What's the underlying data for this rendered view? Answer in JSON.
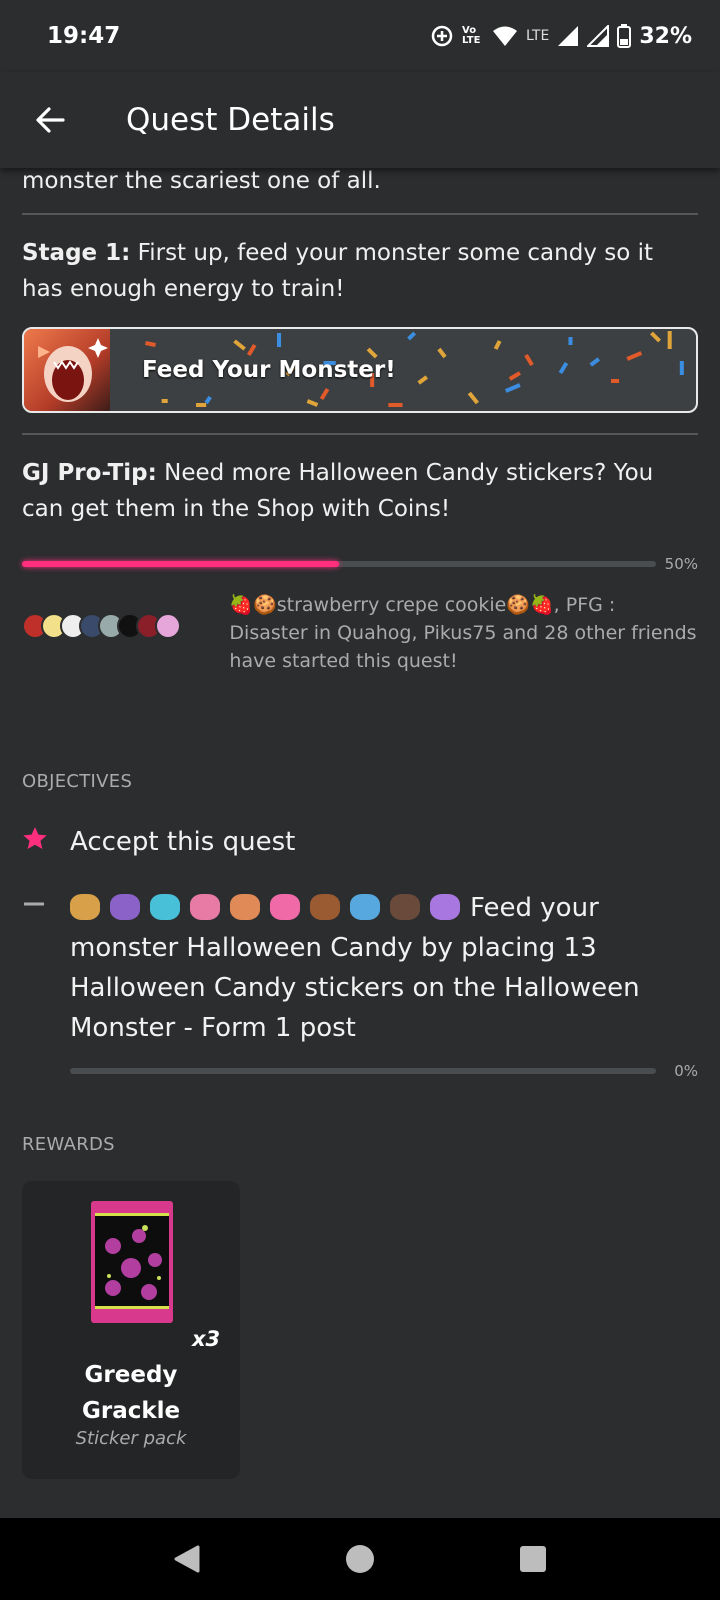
{
  "status_bar": {
    "time": "19:47",
    "network_small": "LTE",
    "volte": "Vo LTE",
    "battery": "32%"
  },
  "app_bar": {
    "title": "Quest Details",
    "back_icon": "arrow-left-icon"
  },
  "intro": {
    "tail_text": "monster the scariest one of all."
  },
  "stage": {
    "label": "Stage 1:",
    "text": " First up, feed your monster some candy so it has enough energy to train!"
  },
  "banner": {
    "label": "Feed Your Monster!"
  },
  "tip": {
    "label": "GJ Pro-Tip:",
    "text": " Need more Halloween Candy stickers? You can get them in the Shop with Coins!"
  },
  "quest_progress": {
    "value": 0.5,
    "text": "50%"
  },
  "friends": {
    "text": "🍓🍪strawberry crepe cookie🍪🍓, PFG : Disaster in Quahog, Pikus75 and 28 other friends have started this quest!"
  },
  "objectives": {
    "heading": "OBJECTIVES",
    "items": [
      {
        "icon": "star-icon",
        "text": "Accept this quest"
      },
      {
        "icon": "dash-icon",
        "text": "Feed your monster Halloween Candy by placing 13 Halloween Candy stickers on the Halloween Monster - Form 1 post",
        "progress": 0.0,
        "progress_text": "0%"
      }
    ]
  },
  "rewards": {
    "heading": "REWARDS",
    "items": [
      {
        "name": "Greedy Grackle",
        "type": "Sticker pack",
        "multiplier": "x3"
      }
    ]
  },
  "colors": {
    "accent": "#ff2f7e",
    "background": "#2b2d2e",
    "card": "#232526"
  }
}
